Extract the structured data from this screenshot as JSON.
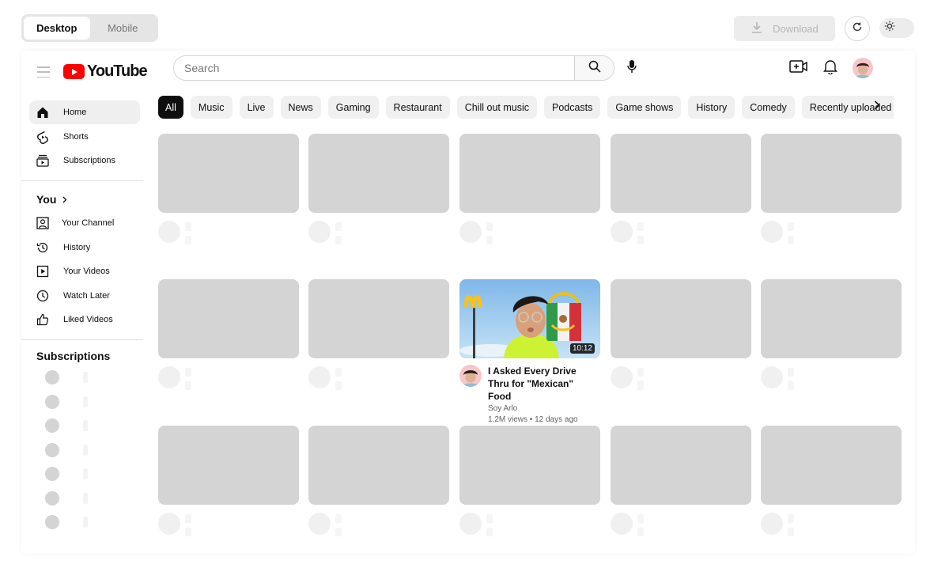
{
  "toolbar": {
    "device_options": [
      "Desktop",
      "Mobile"
    ],
    "selected_device": "Desktop",
    "download_label": "Download"
  },
  "header": {
    "logo_text": "YouTube",
    "search_placeholder": "Search"
  },
  "sidebar": {
    "main": [
      {
        "label": "Home",
        "icon": "home-icon",
        "active": true
      },
      {
        "label": "Shorts",
        "icon": "shorts-icon"
      },
      {
        "label": "Subscriptions",
        "icon": "subscriptions-icon"
      }
    ],
    "you_title": "You",
    "you_items": [
      {
        "label": "Your Channel",
        "icon": "channel-icon"
      },
      {
        "label": "History",
        "icon": "history-icon"
      },
      {
        "label": "Your Videos",
        "icon": "your-videos-icon"
      },
      {
        "label": "Watch Later",
        "icon": "clock-icon"
      },
      {
        "label": "Liked Videos",
        "icon": "thumbs-up-icon"
      }
    ],
    "subscriptions_title": "Subscriptions"
  },
  "chips": [
    "All",
    "Music",
    "Live",
    "News",
    "Gaming",
    "Restaurant",
    "Chill out music",
    "Podcasts",
    "Game shows",
    "History",
    "Comedy",
    "Recently uploaded"
  ],
  "video": {
    "title": "I Asked Every Drive Thru for \"Mexican\" Food",
    "channel": "Soy Arlo",
    "views": "1.2M views",
    "age": "12 days ago",
    "separator": "•",
    "duration": "10:12"
  },
  "colors": {
    "brand_red": "#ff0000",
    "placeholder_gray": "#d4d4d4",
    "chip_bg": "#f0f0f0",
    "active_chip_bg": "#0f0f0f"
  }
}
